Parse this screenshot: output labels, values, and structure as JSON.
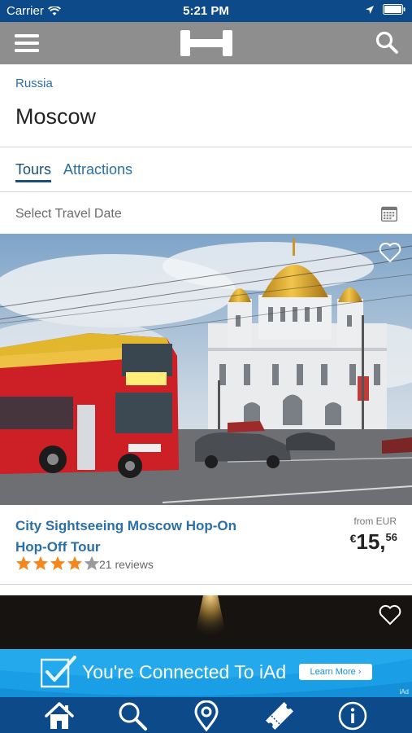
{
  "status_bar": {
    "carrier": "Carrier",
    "time": "5:21 PM"
  },
  "breadcrumb": "Russia",
  "page_title": "Moscow",
  "tabs": [
    {
      "label": "Tours",
      "active": true
    },
    {
      "label": "Attractions",
      "active": false
    }
  ],
  "date_picker": {
    "label": "Select Travel Date"
  },
  "tour": {
    "title": "City Sightseeing Moscow Hop-On Hop-Off Tour",
    "price_prefix": "from EUR",
    "currency_symbol": "€",
    "price_whole": "15,",
    "price_fraction": "56",
    "rating": 4,
    "rating_max": 5,
    "reviews": "21 reviews"
  },
  "ad": {
    "text": "You're Connected To iAd",
    "button": "Learn More ›",
    "mark": "iAd"
  },
  "colors": {
    "brand_blue": "#0d4a8a",
    "link_blue": "#2a6fa8",
    "star": "#f5871f",
    "ad_blue": "#1a9fe6"
  },
  "icons": {
    "navbar": [
      "menu-icon",
      "logo-icon",
      "search-icon"
    ],
    "tabbar": [
      "home-icon",
      "search-icon",
      "map-pin-icon",
      "ticket-icon",
      "info-icon"
    ]
  }
}
